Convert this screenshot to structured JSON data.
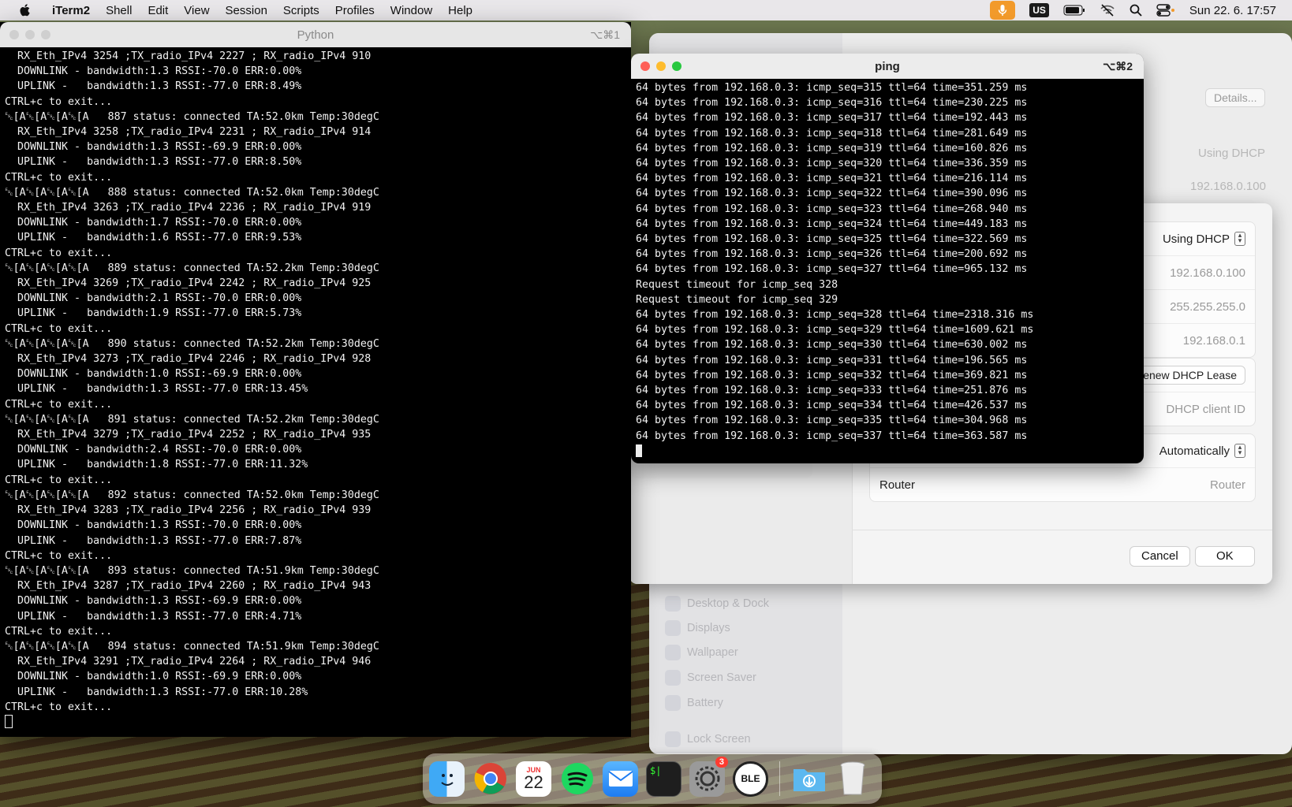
{
  "menubar": {
    "app_name": "iTerm2",
    "items": [
      "Shell",
      "Edit",
      "View",
      "Session",
      "Scripts",
      "Profiles",
      "Window",
      "Help"
    ],
    "keyboard_layout": "US",
    "datetime": "Sun 22. 6.  17:57"
  },
  "python_window": {
    "title": "Python",
    "shortcut": "⌥⌘1",
    "lines": [
      "  RX_Eth_IPv4 3254 ;TX_radio_IPv4 2227 ; RX_radio_IPv4 910",
      "  DOWNLINK - bandwidth:1.3 RSSI:-70.0 ERR:0.00%",
      "  UPLINK -   bandwidth:1.3 RSSI:-77.0 ERR:8.49%",
      "CTRL+c to exit...",
      "␛[A␛[A␛[A␛[A   887 status: connected TA:52.0km Temp:30degC",
      "  RX_Eth_IPv4 3258 ;TX_radio_IPv4 2231 ; RX_radio_IPv4 914",
      "  DOWNLINK - bandwidth:1.3 RSSI:-69.9 ERR:0.00%",
      "  UPLINK -   bandwidth:1.3 RSSI:-77.0 ERR:8.50%",
      "CTRL+c to exit...",
      "␛[A␛[A␛[A␛[A   888 status: connected TA:52.0km Temp:30degC",
      "  RX_Eth_IPv4 3263 ;TX_radio_IPv4 2236 ; RX_radio_IPv4 919",
      "  DOWNLINK - bandwidth:1.7 RSSI:-70.0 ERR:0.00%",
      "  UPLINK -   bandwidth:1.6 RSSI:-77.0 ERR:9.53%",
      "CTRL+c to exit...",
      "␛[A␛[A␛[A␛[A   889 status: connected TA:52.2km Temp:30degC",
      "  RX_Eth_IPv4 3269 ;TX_radio_IPv4 2242 ; RX_radio_IPv4 925",
      "  DOWNLINK - bandwidth:2.1 RSSI:-70.0 ERR:0.00%",
      "  UPLINK -   bandwidth:1.9 RSSI:-77.0 ERR:5.73%",
      "CTRL+c to exit...",
      "␛[A␛[A␛[A␛[A   890 status: connected TA:52.2km Temp:30degC",
      "  RX_Eth_IPv4 3273 ;TX_radio_IPv4 2246 ; RX_radio_IPv4 928",
      "  DOWNLINK - bandwidth:1.0 RSSI:-69.9 ERR:0.00%",
      "  UPLINK -   bandwidth:1.3 RSSI:-77.0 ERR:13.45%",
      "CTRL+c to exit...",
      "␛[A␛[A␛[A␛[A   891 status: connected TA:52.2km Temp:30degC",
      "  RX_Eth_IPv4 3279 ;TX_radio_IPv4 2252 ; RX_radio_IPv4 935",
      "  DOWNLINK - bandwidth:2.4 RSSI:-70.0 ERR:0.00%",
      "  UPLINK -   bandwidth:1.8 RSSI:-77.0 ERR:11.32%",
      "CTRL+c to exit...",
      "␛[A␛[A␛[A␛[A   892 status: connected TA:52.0km Temp:30degC",
      "  RX_Eth_IPv4 3283 ;TX_radio_IPv4 2256 ; RX_radio_IPv4 939",
      "  DOWNLINK - bandwidth:1.3 RSSI:-70.0 ERR:0.00%",
      "  UPLINK -   bandwidth:1.3 RSSI:-77.0 ERR:7.87%",
      "CTRL+c to exit...",
      "␛[A␛[A␛[A␛[A   893 status: connected TA:51.9km Temp:30degC",
      "  RX_Eth_IPv4 3287 ;TX_radio_IPv4 2260 ; RX_radio_IPv4 943",
      "  DOWNLINK - bandwidth:1.3 RSSI:-69.9 ERR:0.00%",
      "  UPLINK -   bandwidth:1.3 RSSI:-77.0 ERR:4.71%",
      "CTRL+c to exit...",
      "␛[A␛[A␛[A␛[A   894 status: connected TA:51.9km Temp:30degC",
      "  RX_Eth_IPv4 3291 ;TX_radio_IPv4 2264 ; RX_radio_IPv4 946",
      "  DOWNLINK - bandwidth:1.0 RSSI:-69.9 ERR:0.00%",
      "  UPLINK -   bandwidth:1.3 RSSI:-77.0 ERR:10.28%",
      "CTRL+c to exit..."
    ]
  },
  "ping_window": {
    "title": "ping",
    "shortcut": "⌥⌘2",
    "lines": [
      "64 bytes from 192.168.0.3: icmp_seq=315 ttl=64 time=351.259 ms",
      "64 bytes from 192.168.0.3: icmp_seq=316 ttl=64 time=230.225 ms",
      "64 bytes from 192.168.0.3: icmp_seq=317 ttl=64 time=192.443 ms",
      "64 bytes from 192.168.0.3: icmp_seq=318 ttl=64 time=281.649 ms",
      "64 bytes from 192.168.0.3: icmp_seq=319 ttl=64 time=160.826 ms",
      "64 bytes from 192.168.0.3: icmp_seq=320 ttl=64 time=336.359 ms",
      "64 bytes from 192.168.0.3: icmp_seq=321 ttl=64 time=216.114 ms",
      "64 bytes from 192.168.0.3: icmp_seq=322 ttl=64 time=390.096 ms",
      "64 bytes from 192.168.0.3: icmp_seq=323 ttl=64 time=268.940 ms",
      "64 bytes from 192.168.0.3: icmp_seq=324 ttl=64 time=449.183 ms",
      "64 bytes from 192.168.0.3: icmp_seq=325 ttl=64 time=322.569 ms",
      "64 bytes from 192.168.0.3: icmp_seq=326 ttl=64 time=200.692 ms",
      "64 bytes from 192.168.0.3: icmp_seq=327 ttl=64 time=965.132 ms",
      "Request timeout for icmp_seq 328",
      "Request timeout for icmp_seq 329",
      "64 bytes from 192.168.0.3: icmp_seq=328 ttl=64 time=2318.316 ms",
      "64 bytes from 192.168.0.3: icmp_seq=329 ttl=64 time=1609.621 ms",
      "64 bytes from 192.168.0.3: icmp_seq=330 ttl=64 time=630.002 ms",
      "64 bytes from 192.168.0.3: icmp_seq=331 ttl=64 time=196.565 ms",
      "64 bytes from 192.168.0.3: icmp_seq=332 ttl=64 time=369.821 ms",
      "64 bytes from 192.168.0.3: icmp_seq=333 ttl=64 time=251.876 ms",
      "64 bytes from 192.168.0.3: icmp_seq=334 ttl=64 time=426.537 ms",
      "64 bytes from 192.168.0.3: icmp_seq=335 ttl=64 time=304.968 ms",
      "64 bytes from 192.168.0.3: icmp_seq=337 ttl=64 time=363.587 ms"
    ]
  },
  "settings": {
    "details_label": "Details...",
    "bg_configure": "Using DHCP",
    "bg_ip": "192.168.0.100",
    "sidebar": [
      "Desktop & Dock",
      "Displays",
      "Wallpaper",
      "Screen Saver",
      "Battery",
      "Lock Screen"
    ]
  },
  "tcpip": {
    "configure_ipv4": "Using DHCP",
    "ip_address": "192.168.0.100",
    "subnet_mask": "255.255.255.0",
    "router_v4": "192.168.0.1",
    "renew_label": "enew DHCP Lease",
    "client_id_placeholder": "DHCP client ID",
    "configure_ipv6": "Automatically",
    "router_label": "Router",
    "router_placeholder": "Router",
    "cancel_label": "Cancel",
    "ok_label": "OK"
  },
  "dock": {
    "calendar_month": "JUN",
    "calendar_day": "22",
    "settings_badge": "3",
    "terminal_glyph": "$|",
    "ble_label": "BLE"
  },
  "colors": {
    "close": "#fe5f57",
    "minimize": "#febc2e",
    "zoom": "#28c840",
    "inactive_light": "#c9c9c9"
  }
}
